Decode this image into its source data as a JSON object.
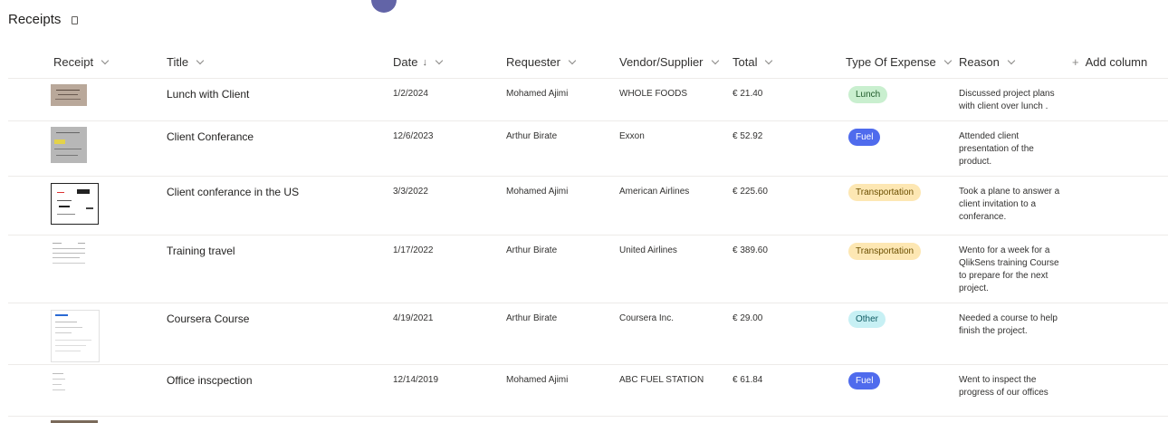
{
  "list": {
    "title": "Receipts"
  },
  "columns": {
    "receipt": "Receipt",
    "title": "Title",
    "date": "Date",
    "date_sort": "↓",
    "requester": "Requester",
    "vendor": "Vendor/Supplier",
    "total": "Total",
    "type": "Type Of Expense",
    "reason": "Reason",
    "add_plus": "+",
    "add": "Add column"
  },
  "rows": [
    {
      "title": "Lunch with Client",
      "date": "1/2/2024",
      "requester": "Mohamed Ajimi",
      "vendor": "WHOLE FOODS",
      "total": "€ 21.40",
      "type": "Lunch",
      "reason": "Discussed project plans with client over lunch ."
    },
    {
      "title": "Client Conferance",
      "date": "12/6/2023",
      "requester": "Arthur Birate",
      "vendor": "Exxon",
      "total": "€ 52.92",
      "type": "Fuel",
      "reason": "Attended client presentation of the product."
    },
    {
      "title": "Client conferance in the US",
      "date": "3/3/2022",
      "requester": "Mohamed Ajimi",
      "vendor": "American Airlines",
      "total": "€ 225.60",
      "type": "Transportation",
      "reason": "Took a plane to answer a client invitation to a conferance."
    },
    {
      "title": "Training travel",
      "date": "1/17/2022",
      "requester": "Arthur Birate",
      "vendor": "United Airlines",
      "total": "€ 389.60",
      "type": "Transportation",
      "reason": "Wento for a week for a QlikSens training Course to prepare for the next project."
    },
    {
      "title": "Coursera Course",
      "date": "4/19/2021",
      "requester": "Arthur Birate",
      "vendor": "Coursera Inc.",
      "total": "€ 29.00",
      "type": "Other",
      "reason": "Needed a course to help finish the project."
    },
    {
      "title": "Office inscpection",
      "date": "12/14/2019",
      "requester": "Mohamed Ajimi",
      "vendor": "ABC FUEL STATION",
      "total": "€ 61.84",
      "type": "Fuel",
      "reason": "Went to inspect the progress of our offices"
    }
  ],
  "icons": {
    "sort": "chevron-down-icon",
    "favorite": "bookmark-icon",
    "add": "plus-icon"
  }
}
